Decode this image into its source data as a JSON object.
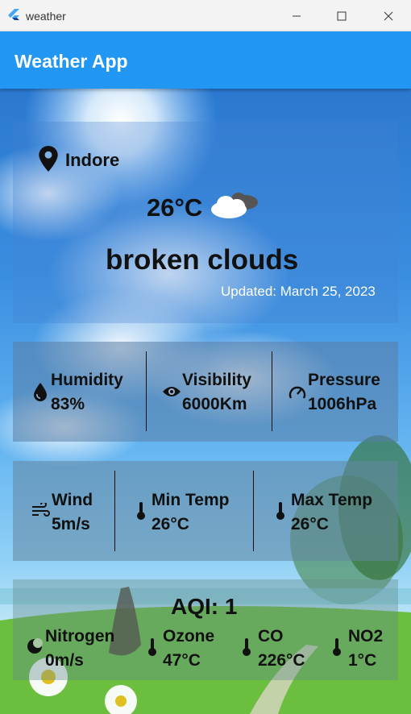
{
  "window": {
    "title": "weather"
  },
  "appbar": {
    "title": "Weather App"
  },
  "current": {
    "location": "Indore",
    "temperature": "26°C",
    "description": "broken clouds",
    "updated": "Updated: March 25, 2023"
  },
  "metrics_row1": [
    {
      "label": "Humidity",
      "value": "83%",
      "icon": "water-drop-icon"
    },
    {
      "label": "Visibility",
      "value": "6000Km",
      "icon": "eye-icon"
    },
    {
      "label": "Pressure",
      "value": "1006hPa",
      "icon": "speedometer-icon"
    }
  ],
  "metrics_row2": [
    {
      "label": "Wind",
      "value": "5m/s",
      "icon": "wind-icon"
    },
    {
      "label": "Min Temp",
      "value": "26°C",
      "icon": "thermometer-icon"
    },
    {
      "label": "Max Temp",
      "value": "26°C",
      "icon": "thermometer-icon"
    }
  ],
  "aqi": {
    "title": "AQI: 1",
    "items": [
      {
        "label": "Nitrogen",
        "value": "0m/s",
        "icon": "moon-icon"
      },
      {
        "label": "Ozone",
        "value": "47°C",
        "icon": "thermometer-icon"
      },
      {
        "label": "CO",
        "value": "226°C",
        "icon": "thermometer-icon"
      },
      {
        "label": "NO2",
        "value": "1°C",
        "icon": "thermometer-icon"
      }
    ]
  },
  "colors": {
    "appbar": "#2196f3",
    "text": "#111111",
    "updated_text": "#ffffff"
  }
}
